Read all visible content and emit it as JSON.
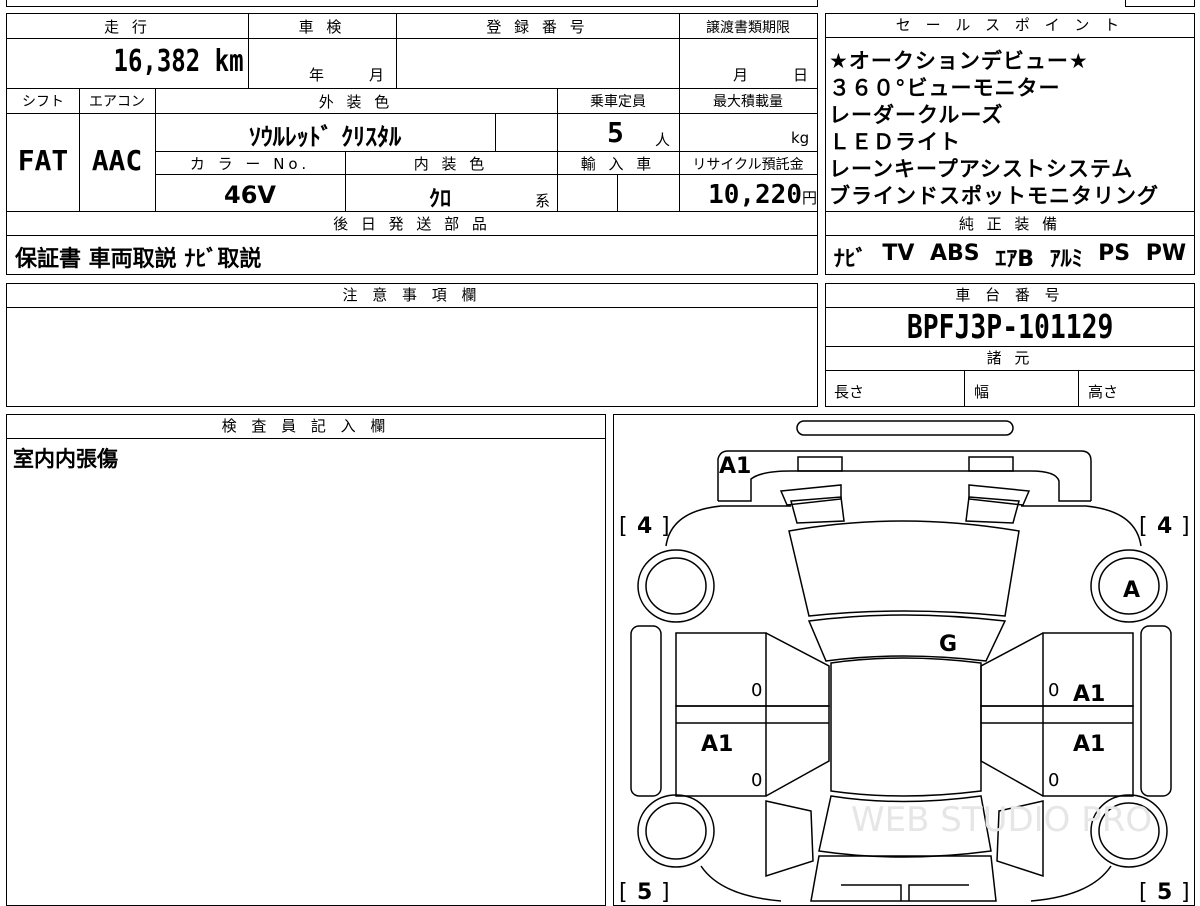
{
  "vehicle": {
    "mileage_label": "走 行",
    "mileage_value": "16,382",
    "mileage_unit": "km",
    "inspection_label": "車 検",
    "inspection_year": "年",
    "inspection_month": "月",
    "registration_label": "登 録 番 号",
    "transfer_label": "譲渡書類期限",
    "transfer_month": "月",
    "transfer_day": "日",
    "shift_label": "シフト",
    "shift_value": "FAT",
    "ac_label": "エアコン",
    "ac_value": "AAC",
    "exterior_label": "外 装 色",
    "exterior_value": "ｿｳﾙﾚｯﾄﾞ ｸﾘｽﾀﾙ",
    "capacity_label": "乗車定員",
    "capacity_value": "5",
    "capacity_unit": "人",
    "max_load_label": "最大積載量",
    "max_load_unit": "kg",
    "color_no_label": "カ ラ ー No.",
    "color_no_value": "46V",
    "interior_label": "内 装 色",
    "interior_value": "ｸﾛ",
    "interior_suffix": "系",
    "import_label": "輸 入 車",
    "recycle_label": "リサイクル預託金",
    "recycle_value": "10,220",
    "recycle_unit": "円",
    "later_parts_label": "後 日 発 送 部 品",
    "later_parts_value": "保証書 車両取説 ﾅﾋﾞ取説"
  },
  "sales_points": {
    "label": "セ ー ル ス ポ イ ン ト",
    "items": [
      "★オークションデビュー★",
      "３６０°ビューモニター",
      "レーダークルーズ",
      "ＬＥＤライト",
      "レーンキープアシストシステム",
      "ブラインドスポットモニタリング"
    ]
  },
  "equipment": {
    "label": "純 正 装 備",
    "items": [
      "ﾅﾋﾞ",
      "TV",
      "ABS",
      "ｴｱB",
      "ｱﾙﾐ",
      "PS",
      "PW"
    ]
  },
  "notes": {
    "label": "注 意 事 項 欄"
  },
  "chassis": {
    "label": "車 台 番 号",
    "value": "BPFJ3P-101129",
    "specs_label": "諸 元",
    "length_label": "長さ",
    "width_label": "幅",
    "height_label": "高さ"
  },
  "inspector": {
    "label": "検 査 員 記 入 欄",
    "comment": "室内内張傷"
  },
  "diagram": {
    "marks": {
      "front": "A1",
      "windshield": "G",
      "wheel_front_right": "A",
      "door_front_right": "A1",
      "door_rear_left": "A1",
      "door_rear_right": "A1",
      "tire_fl": "4",
      "tire_fr": "4",
      "tire_rl": "5",
      "tire_rr": "5",
      "zero": "0"
    },
    "watermark": "WEB STUDIO PRO"
  }
}
